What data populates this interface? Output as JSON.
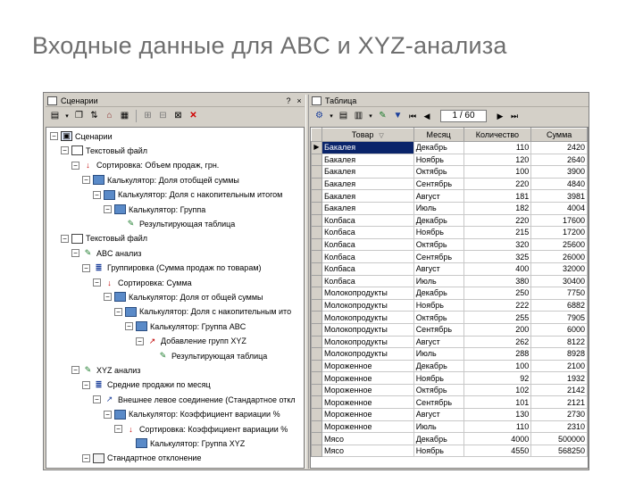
{
  "slide_title": "Входные данные для ABC и XYZ-анализа",
  "left_panel": {
    "title": "Сценарии",
    "help_label": "?",
    "close_label": "×",
    "toolbar_icons": [
      "properties-icon",
      "copy-icon",
      "move-icon",
      "home-icon",
      "report-icon",
      "tree-icon",
      "expand-icon",
      "collapse-icon",
      "delete-icon"
    ],
    "tree": [
      {
        "label": "Сценарии",
        "level": 0,
        "icon": "scenario",
        "expander": "−"
      },
      {
        "label": "Текстовый файл",
        "level": 1,
        "icon": "file",
        "expander": "−"
      },
      {
        "label": "Сортировка: Объем продаж, грн.",
        "level": 2,
        "icon": "sort",
        "expander": "−"
      },
      {
        "label": "Калькулятор: Доля отобщей суммы",
        "level": 3,
        "icon": "calc",
        "expander": "−"
      },
      {
        "label": "Калькулятор: Доля с накопительным итогом",
        "level": 4,
        "icon": "calc",
        "expander": "−"
      },
      {
        "label": "Калькулятор: Группа",
        "level": 5,
        "icon": "calc",
        "expander": "−"
      },
      {
        "label": "Результирующая таблица",
        "level": 6,
        "icon": "result",
        "expander": ""
      },
      {
        "label": "Текстовый файл",
        "level": 1,
        "icon": "file",
        "expander": "−"
      },
      {
        "label": "ABC анализ",
        "level": 2,
        "icon": "abc",
        "expander": "−"
      },
      {
        "label": "Группировка (Сумма продаж по товарам)",
        "level": 3,
        "icon": "group",
        "expander": "−"
      },
      {
        "label": "Сортировка: Сумма",
        "level": 4,
        "icon": "sort",
        "expander": "−"
      },
      {
        "label": "Калькулятор: Доля от общей суммы",
        "level": 5,
        "icon": "calc",
        "expander": "−"
      },
      {
        "label": "Калькулятор: Доля с накопительным ито",
        "level": 6,
        "icon": "calc",
        "expander": "−"
      },
      {
        "label": "Калькулятор: Группа ABC",
        "level": 7,
        "icon": "calc",
        "expander": "−"
      },
      {
        "label": "Добавление групп XYZ",
        "level": 8,
        "icon": "add",
        "expander": "−"
      },
      {
        "label": "Результирующая таблица",
        "level": 9,
        "icon": "result",
        "expander": ""
      },
      {
        "label": "XYZ анализ",
        "level": 2,
        "icon": "abc",
        "expander": "−"
      },
      {
        "label": "Средние продажи по месяц",
        "level": 3,
        "icon": "group",
        "expander": "−"
      },
      {
        "label": "Внешнее левое соединение (Стандартное откл",
        "level": 4,
        "icon": "join",
        "expander": "−"
      },
      {
        "label": "Калькулятор: Коэффициент вариации %",
        "level": 5,
        "icon": "calc",
        "expander": "−"
      },
      {
        "label": "Сортировка: Коэффициент вариации %",
        "level": 6,
        "icon": "sort",
        "expander": "−"
      },
      {
        "label": "Калькулятор: Группа XYZ",
        "level": 7,
        "icon": "calc",
        "expander": ""
      },
      {
        "label": "Стандартное отклонение",
        "level": 3,
        "icon": "std",
        "expander": "−"
      }
    ]
  },
  "right_panel": {
    "title": "Таблица",
    "close_label": "×",
    "nav": {
      "position": "1 / 60",
      "first": "⏮",
      "prev": "◀",
      "next": "▶",
      "last": "⏭"
    },
    "columns": [
      "Товар",
      "Месяц",
      "Количество",
      "Сумма"
    ],
    "rows": [
      [
        "Бакалея",
        "Декабрь",
        "110",
        "2420"
      ],
      [
        "Бакалея",
        "Ноябрь",
        "120",
        "2640"
      ],
      [
        "Бакалея",
        "Октябрь",
        "100",
        "3900"
      ],
      [
        "Бакалея",
        "Сентябрь",
        "220",
        "4840"
      ],
      [
        "Бакалея",
        "Август",
        "181",
        "3981"
      ],
      [
        "Бакалея",
        "Июль",
        "182",
        "4004"
      ],
      [
        "Колбаса",
        "Декабрь",
        "220",
        "17600"
      ],
      [
        "Колбаса",
        "Ноябрь",
        "215",
        "17200"
      ],
      [
        "Колбаса",
        "Октябрь",
        "320",
        "25600"
      ],
      [
        "Колбаса",
        "Сентябрь",
        "325",
        "26000"
      ],
      [
        "Колбаса",
        "Август",
        "400",
        "32000"
      ],
      [
        "Колбаса",
        "Июль",
        "380",
        "30400"
      ],
      [
        "Молокопродукты",
        "Декабрь",
        "250",
        "7750"
      ],
      [
        "Молокопродукты",
        "Ноябрь",
        "222",
        "6882"
      ],
      [
        "Молокопродукты",
        "Октябрь",
        "255",
        "7905"
      ],
      [
        "Молокопродукты",
        "Сентябрь",
        "200",
        "6000"
      ],
      [
        "Молокопродукты",
        "Август",
        "262",
        "8122"
      ],
      [
        "Молокопродукты",
        "Июль",
        "288",
        "8928"
      ],
      [
        "Мороженное",
        "Декабрь",
        "100",
        "2100"
      ],
      [
        "Мороженное",
        "Ноябрь",
        "92",
        "1932"
      ],
      [
        "Мороженное",
        "Октябрь",
        "102",
        "2142"
      ],
      [
        "Мороженное",
        "Сентябрь",
        "101",
        "2121"
      ],
      [
        "Мороженное",
        "Август",
        "130",
        "2730"
      ],
      [
        "Мороженное",
        "Июль",
        "110",
        "2310"
      ],
      [
        "Мясо",
        "Декабрь",
        "4000",
        "500000"
      ],
      [
        "Мясо",
        "Ноябрь",
        "4550",
        "568250"
      ]
    ],
    "selected_row": 0
  }
}
